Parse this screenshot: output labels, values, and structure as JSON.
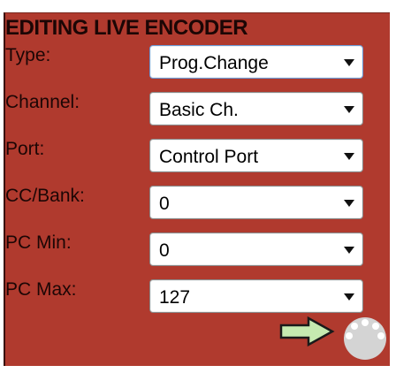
{
  "panel": {
    "title": "EDITING LIVE ENCODER"
  },
  "fields": [
    {
      "label": "Type:",
      "value": "Prog.Change"
    },
    {
      "label": "Channel:",
      "value": "Basic Ch."
    },
    {
      "label": "Port:",
      "value": "Control Port"
    },
    {
      "label": "CC/Bank:",
      "value": "0"
    },
    {
      "label": "PC Min:",
      "value": "0"
    },
    {
      "label": "PC Max:",
      "value": "127"
    }
  ],
  "icons": {
    "next": "arrow-right-icon",
    "knob": "encoder-knob-icon"
  },
  "colors": {
    "panel_background": "#b03a2e",
    "label_text": "#1c0605",
    "arrow_fill": "#c6eab0",
    "knob_fill": "#d4d4d4"
  }
}
